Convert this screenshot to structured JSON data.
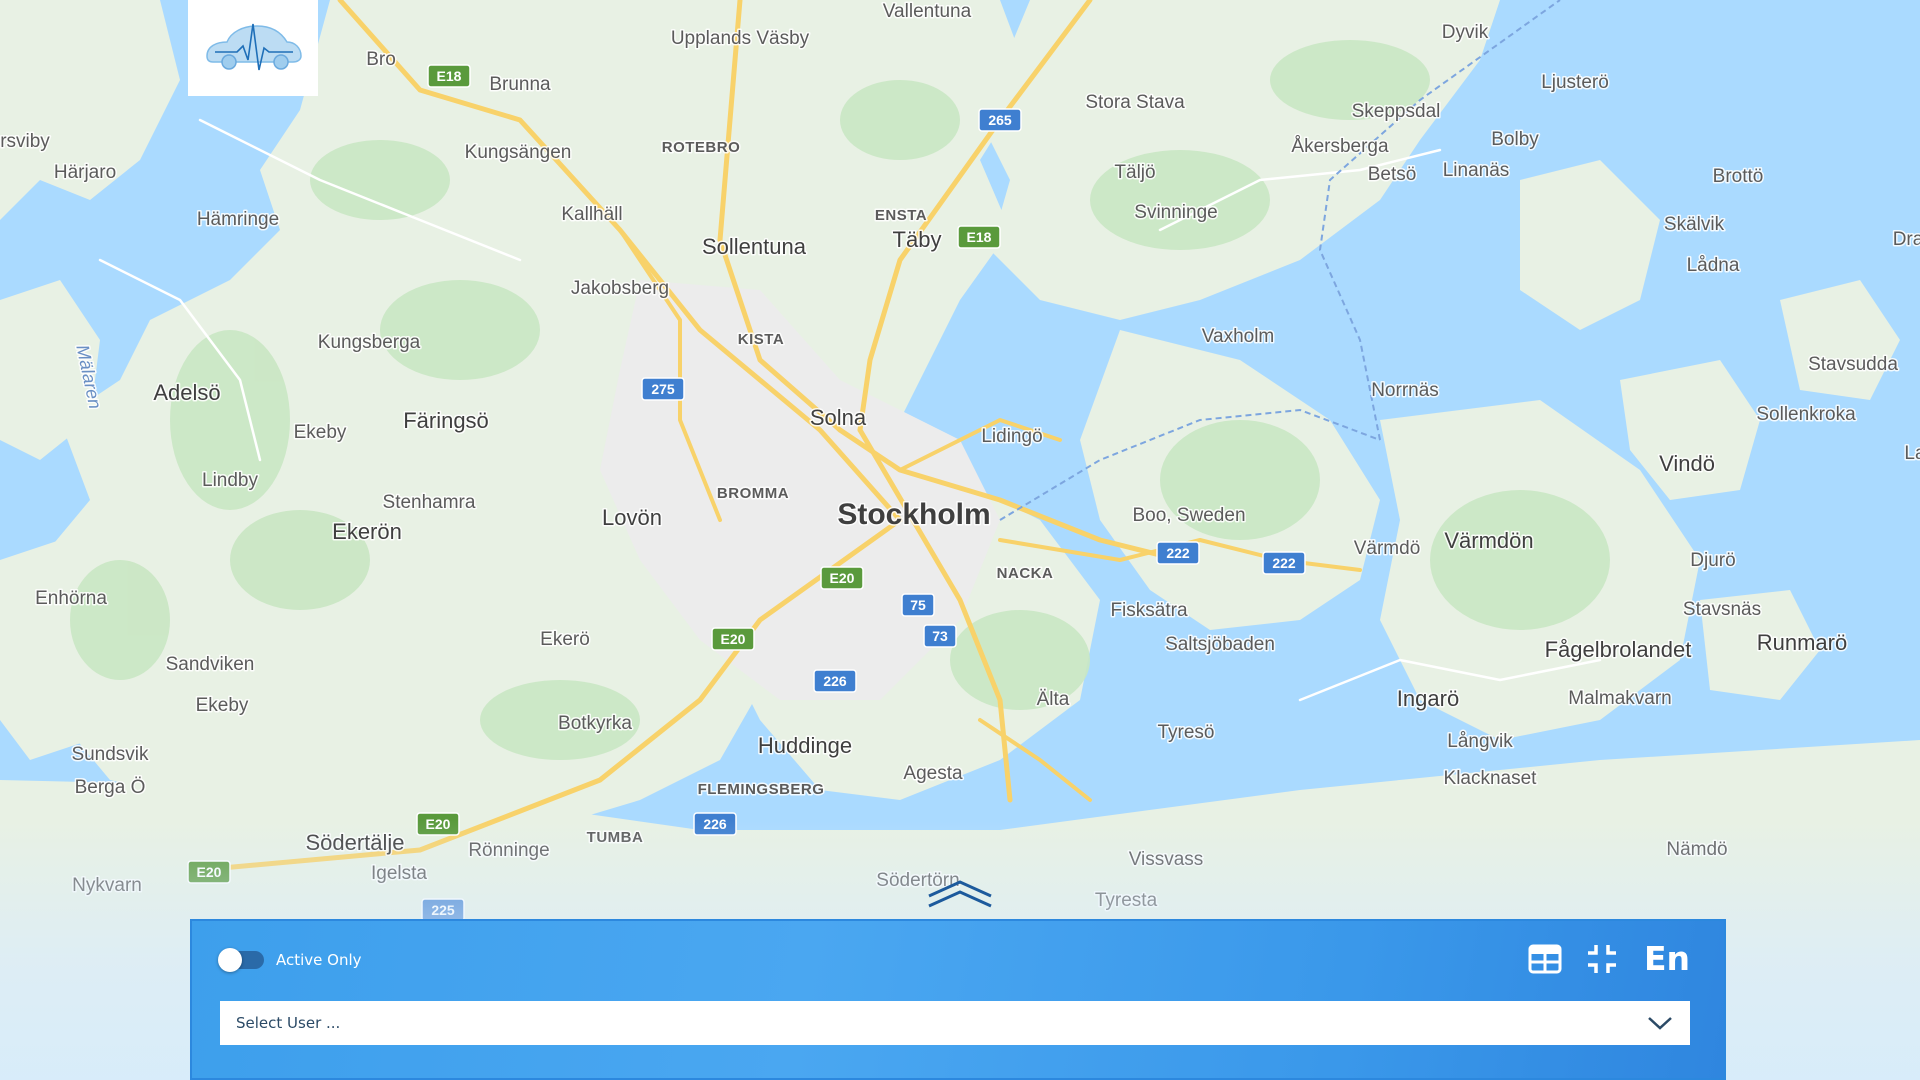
{
  "map": {
    "places": [
      {
        "name": "Vallentuna",
        "kind": "town"
      },
      {
        "name": "Upplands Väsby",
        "kind": "town"
      },
      {
        "name": "Dyvik",
        "kind": "town"
      },
      {
        "name": "Ljusterö",
        "kind": "town"
      },
      {
        "name": "Bro",
        "kind": "town"
      },
      {
        "name": "Brunna",
        "kind": "town"
      },
      {
        "name": "Stora Stava",
        "kind": "town"
      },
      {
        "name": "Skeppsdal",
        "kind": "town"
      },
      {
        "name": "rsviby",
        "kind": "town"
      },
      {
        "name": "Härjaro",
        "kind": "town"
      },
      {
        "name": "Kungsängen",
        "kind": "town"
      },
      {
        "name": "ROTEBRO",
        "kind": "district"
      },
      {
        "name": "Åkersberga",
        "kind": "town"
      },
      {
        "name": "Bolby",
        "kind": "town"
      },
      {
        "name": "Täljö",
        "kind": "town"
      },
      {
        "name": "Betsö",
        "kind": "town"
      },
      {
        "name": "Linanäs",
        "kind": "town"
      },
      {
        "name": "Brottö",
        "kind": "town"
      },
      {
        "name": "Kallhäll",
        "kind": "town"
      },
      {
        "name": "ENSTA",
        "kind": "district"
      },
      {
        "name": "Svinninge",
        "kind": "town"
      },
      {
        "name": "Hämringe",
        "kind": "town"
      },
      {
        "name": "Skälvik",
        "kind": "town"
      },
      {
        "name": "Täby",
        "kind": "major"
      },
      {
        "name": "Sollentuna",
        "kind": "major"
      },
      {
        "name": "Dra",
        "kind": "town"
      },
      {
        "name": "Lådna",
        "kind": "town"
      },
      {
        "name": "Jakobsberg",
        "kind": "town"
      },
      {
        "name": "Vaxholm",
        "kind": "town"
      },
      {
        "name": "Mälaren",
        "kind": "water"
      },
      {
        "name": "KISTA",
        "kind": "district"
      },
      {
        "name": "Kungsberga",
        "kind": "town"
      },
      {
        "name": "Stavsudda",
        "kind": "town"
      },
      {
        "name": "Norrnäs",
        "kind": "town"
      },
      {
        "name": "Adelsö",
        "kind": "major"
      },
      {
        "name": "Solna",
        "kind": "major"
      },
      {
        "name": "Sollenkroka",
        "kind": "town"
      },
      {
        "name": "Färingsö",
        "kind": "major"
      },
      {
        "name": "Lidingö",
        "kind": "town"
      },
      {
        "name": "Ekeby",
        "kind": "town"
      },
      {
        "name": "Vindö",
        "kind": "major"
      },
      {
        "name": "La",
        "kind": "town"
      },
      {
        "name": "Lindby",
        "kind": "town"
      },
      {
        "name": "BROMMA",
        "kind": "district"
      },
      {
        "name": "Stenhamra",
        "kind": "town"
      },
      {
        "name": "Boo, Sweden",
        "kind": "town"
      },
      {
        "name": "Lovön",
        "kind": "major"
      },
      {
        "name": "Stockholm",
        "kind": "city"
      },
      {
        "name": "Ekerön",
        "kind": "major"
      },
      {
        "name": "Värmdö",
        "kind": "town"
      },
      {
        "name": "Värmdön",
        "kind": "major"
      },
      {
        "name": "Djurö",
        "kind": "town"
      },
      {
        "name": "NACKA",
        "kind": "district"
      },
      {
        "name": "Enhörna",
        "kind": "town"
      },
      {
        "name": "Fisksätra",
        "kind": "town"
      },
      {
        "name": "Stavsnäs",
        "kind": "town"
      },
      {
        "name": "Ekerö",
        "kind": "town"
      },
      {
        "name": "Saltsjöbaden",
        "kind": "town"
      },
      {
        "name": "Fågelbrolandet",
        "kind": "major"
      },
      {
        "name": "Runmarö",
        "kind": "major"
      },
      {
        "name": "Sandviken",
        "kind": "town"
      },
      {
        "name": "Ingarö",
        "kind": "major"
      },
      {
        "name": "Malmakvarn",
        "kind": "town"
      },
      {
        "name": "Älta",
        "kind": "town"
      },
      {
        "name": "Ekeby",
        "kind": "town"
      },
      {
        "name": "Botkyrka",
        "kind": "town"
      },
      {
        "name": "Tyresö",
        "kind": "town"
      },
      {
        "name": "Långvik",
        "kind": "town"
      },
      {
        "name": "Huddinge",
        "kind": "major"
      },
      {
        "name": "Sundsvik",
        "kind": "town"
      },
      {
        "name": "Agesta",
        "kind": "town"
      },
      {
        "name": "Klacknaset",
        "kind": "town"
      },
      {
        "name": "Berga Ö",
        "kind": "town"
      },
      {
        "name": "FLEMINGSBERG",
        "kind": "district"
      },
      {
        "name": "Södertälje",
        "kind": "major"
      },
      {
        "name": "Rönninge",
        "kind": "town"
      },
      {
        "name": "TUMBA",
        "kind": "district"
      },
      {
        "name": "Nämdö",
        "kind": "town"
      },
      {
        "name": "Nykvarn",
        "kind": "town"
      },
      {
        "name": "Igelsta",
        "kind": "town"
      },
      {
        "name": "Vissvass",
        "kind": "town"
      },
      {
        "name": "Södertörn",
        "kind": "town"
      },
      {
        "name": "Tyresta",
        "kind": "town"
      }
    ],
    "road_shields": [
      {
        "label": "E18",
        "type": "european"
      },
      {
        "label": "265",
        "type": "national"
      },
      {
        "label": "E18",
        "type": "european"
      },
      {
        "label": "275",
        "type": "national"
      },
      {
        "label": "222",
        "type": "national"
      },
      {
        "label": "222",
        "type": "national"
      },
      {
        "label": "E20",
        "type": "european"
      },
      {
        "label": "75",
        "type": "national"
      },
      {
        "label": "E20",
        "type": "european"
      },
      {
        "label": "73",
        "type": "national"
      },
      {
        "label": "226",
        "type": "national"
      },
      {
        "label": "E20",
        "type": "european"
      },
      {
        "label": "226",
        "type": "national"
      },
      {
        "label": "E20",
        "type": "european"
      },
      {
        "label": "225",
        "type": "national"
      }
    ],
    "colors": {
      "water": "#aadaff",
      "land": "#e8f1e4",
      "forest": "#c9e7c3",
      "urban": "#ececec",
      "road_major": "#f8d26a",
      "road_minor": "#ffffff",
      "european_shield": "#5a9a3c",
      "national_shield": "#3f7fd0"
    }
  },
  "panel": {
    "toggle": {
      "label": "Active Only",
      "on": false
    },
    "tools": {
      "grid_icon": "grid-table-icon",
      "fit_icon": "collapse-arrows-icon",
      "language": "En"
    },
    "user_select": {
      "placeholder": "Select User ...",
      "icon": "chevron-down-icon"
    },
    "colors": {
      "panel_bg": "#3d9fec",
      "panel_border": "#2c88de",
      "text": "#ffffff"
    }
  },
  "logo": {
    "icon": "car-heartbeat-logo-icon"
  },
  "collapse_chevron": {
    "icon": "double-chevron-up-icon"
  }
}
